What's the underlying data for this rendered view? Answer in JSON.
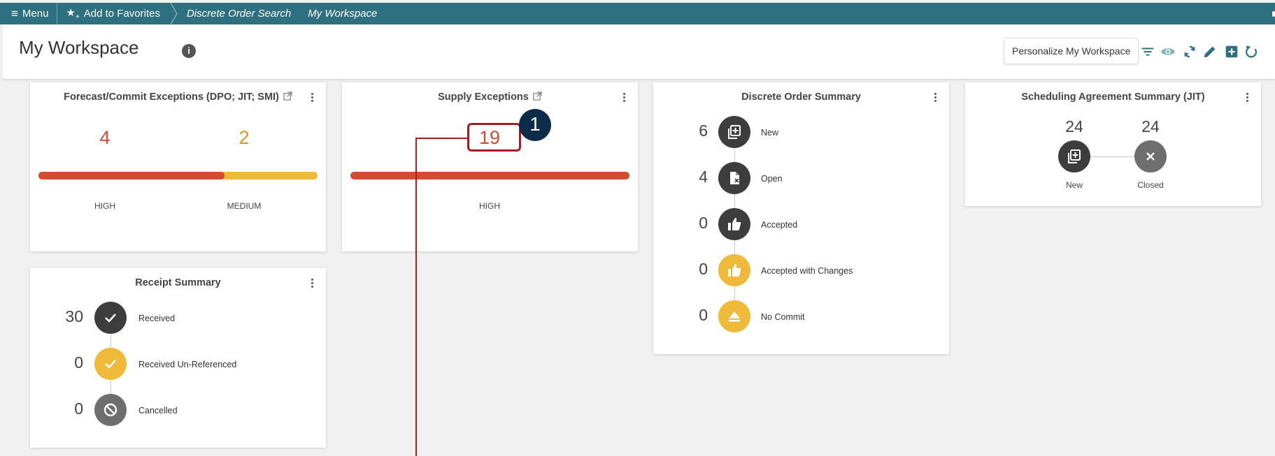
{
  "topbar": {
    "menu_label": "Menu",
    "favorites_label": "Add to Favorites",
    "breadcrumbs": [
      "Discrete Order Search",
      "My Workspace"
    ]
  },
  "header": {
    "title": "My Workspace",
    "personalize_label": "Personalize My Workspace",
    "tools": [
      "filter-icon",
      "eye-icon",
      "refresh-icon",
      "edit-icon",
      "add-box-icon",
      "undo-icon"
    ]
  },
  "forecast": {
    "title": "Forecast/Commit Exceptions (DPO; JIT; SMI)",
    "high_value": "4",
    "medium_value": "2",
    "high_label": "HIGH",
    "medium_label": "MEDIUM",
    "high_fraction": 0.667,
    "medium_fraction": 0.333
  },
  "supply": {
    "title": "Supply Exceptions",
    "high_value": "19",
    "high_label": "HIGH",
    "high_fraction": 1.0
  },
  "discrete": {
    "title": "Discrete Order Summary",
    "rows": [
      {
        "value": "6",
        "label": "New",
        "icon": "add-document-icon",
        "color": "#3d3d3d"
      },
      {
        "value": "4",
        "label": "Open",
        "icon": "open-document-icon",
        "color": "#3d3d3d"
      },
      {
        "value": "0",
        "label": "Accepted",
        "icon": "thumbs-up-icon",
        "color": "#3d3d3d"
      },
      {
        "value": "0",
        "label": "Accepted with Changes",
        "icon": "thumbs-up-icon",
        "color": "#efb93a"
      },
      {
        "value": "0",
        "label": "No Commit",
        "icon": "eject-icon",
        "color": "#efb93a"
      }
    ]
  },
  "scheduling": {
    "title": "Scheduling Agreement Summary (JIT)",
    "new_value": "24",
    "closed_value": "24",
    "new_label": "New",
    "closed_label": "Closed"
  },
  "receipt": {
    "title": "Receipt Summary",
    "rows": [
      {
        "value": "30",
        "label": "Received",
        "icon": "check-icon",
        "color": "#3d3d3d"
      },
      {
        "value": "0",
        "label": "Received Un-Referenced",
        "icon": "check-icon",
        "color": "#efb93a"
      },
      {
        "value": "0",
        "label": "Cancelled",
        "icon": "block-icon",
        "color": "#6e6e6e"
      }
    ]
  },
  "callout": {
    "number": "1"
  },
  "colors": {
    "topbar": "#2e6f80",
    "high": "#d44a32",
    "medium": "#efb93a",
    "callout": "#a51e1e",
    "badge": "#0d2c4a"
  }
}
